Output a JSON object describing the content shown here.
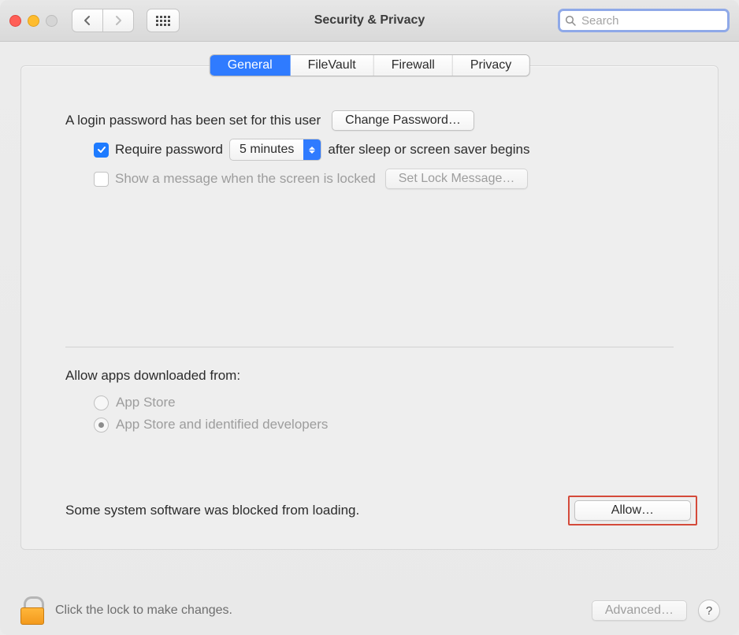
{
  "titlebar": {
    "title": "Security & Privacy",
    "search_placeholder": "Search"
  },
  "tabs": {
    "general": "General",
    "filevault": "FileVault",
    "firewall": "Firewall",
    "privacy": "Privacy",
    "active": "general"
  },
  "general": {
    "login_password_text": "A login password has been set for this user",
    "change_password_btn": "Change Password…",
    "require_password_label": "Require password",
    "require_password_delay": "5 minutes",
    "require_password_suffix": "after sleep or screen saver begins",
    "show_message_label": "Show a message when the screen is locked",
    "set_lock_message_btn": "Set Lock Message…",
    "allow_apps_title": "Allow apps downloaded from:",
    "radio_app_store": "App Store",
    "radio_identified": "App Store and identified developers",
    "blocked_text": "Some system software was blocked from loading.",
    "allow_btn": "Allow…"
  },
  "footer": {
    "lock_text": "Click the lock to make changes.",
    "advanced_btn": "Advanced…",
    "help": "?"
  }
}
